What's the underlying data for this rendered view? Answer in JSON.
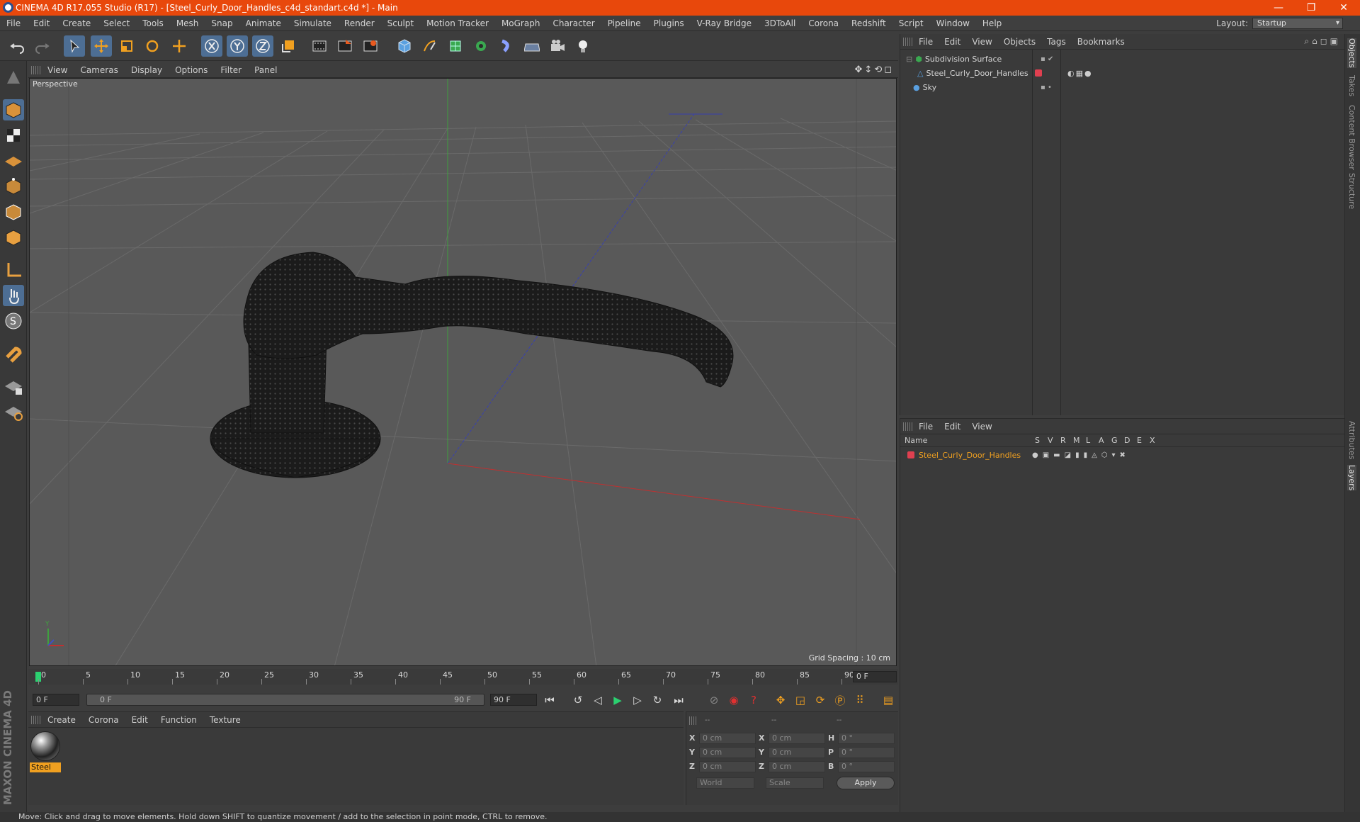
{
  "window": {
    "title": "CINEMA 4D R17.055 Studio (R17) - [Steel_Curly_Door_Handles_c4d_standart.c4d *] - Main"
  },
  "menu": [
    "File",
    "Edit",
    "Create",
    "Select",
    "Tools",
    "Mesh",
    "Snap",
    "Animate",
    "Simulate",
    "Render",
    "Sculpt",
    "Motion Tracker",
    "MoGraph",
    "Character",
    "Pipeline",
    "Plugins",
    "V-Ray Bridge",
    "3DToAll",
    "Corona",
    "Redshift",
    "Script",
    "Window",
    "Help"
  ],
  "layout": {
    "label": "Layout:",
    "value": "Startup"
  },
  "viewport": {
    "menu": [
      "View",
      "Cameras",
      "Display",
      "Options",
      "Filter",
      "Panel"
    ],
    "label": "Perspective",
    "grid_spacing": "Grid Spacing : 10 cm"
  },
  "timeline": {
    "ticks": [
      "0",
      "5",
      "10",
      "15",
      "20",
      "25",
      "30",
      "35",
      "40",
      "45",
      "50",
      "55",
      "60",
      "65",
      "70",
      "75",
      "80",
      "85",
      "90"
    ],
    "current": "0 F",
    "range_start": "0 F",
    "range_inner_start": "0 F",
    "range_inner_end": "90 F",
    "range_end": "90 F"
  },
  "materials": {
    "menu": [
      "Create",
      "Corona",
      "Edit",
      "Function",
      "Texture"
    ],
    "items": [
      {
        "name": "Steel"
      }
    ]
  },
  "coordinates": {
    "header": [
      "--",
      "--",
      "--"
    ],
    "rows": [
      {
        "a": "X",
        "av": "0 cm",
        "b": "X",
        "bv": "0 cm",
        "c": "H",
        "cv": "0 °"
      },
      {
        "a": "Y",
        "av": "0 cm",
        "b": "Y",
        "bv": "0 cm",
        "c": "P",
        "cv": "0 °"
      },
      {
        "a": "Z",
        "av": "0 cm",
        "b": "Z",
        "bv": "0 cm",
        "c": "B",
        "cv": "0 °"
      }
    ],
    "mode": "World",
    "scale": "Scale",
    "apply": "Apply"
  },
  "objects": {
    "menu": [
      "File",
      "Edit",
      "View",
      "Objects",
      "Tags",
      "Bookmarks"
    ],
    "items": [
      {
        "name": "Subdivision Surface",
        "indent": 0
      },
      {
        "name": "Steel_Curly_Door_Handles",
        "indent": 1
      },
      {
        "name": "Sky",
        "indent": 0
      }
    ]
  },
  "layers": {
    "menu": [
      "File",
      "Edit",
      "View"
    ],
    "columns": [
      "Name",
      "S",
      "V",
      "R",
      "M",
      "L",
      "A",
      "G",
      "D",
      "E",
      "X"
    ],
    "items": [
      {
        "name": "Steel_Curly_Door_Handles",
        "color": "#e04050"
      }
    ]
  },
  "right_tabs": [
    "Objects",
    "Takes",
    "Content Browser",
    "Structure",
    "Attributes",
    "Layers"
  ],
  "brand": "MAXON CINEMA 4D",
  "status": "Move: Click and drag to move elements. Hold down SHIFT to quantize movement / add to the selection in point mode, CTRL to remove.",
  "colors": {
    "accent": "#e8480c",
    "active_tool": "#4d6e94",
    "layer": "#e04050"
  }
}
